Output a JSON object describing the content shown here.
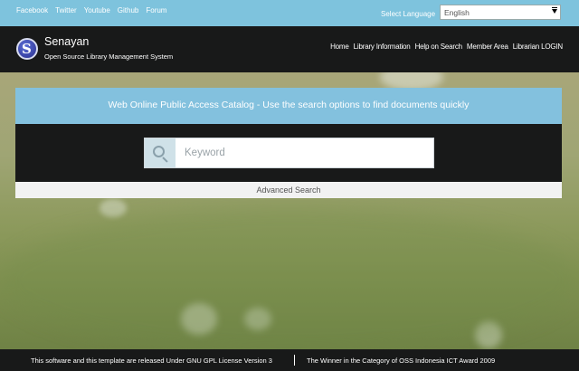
{
  "topbar": {
    "social_links": [
      "Facebook",
      "Twitter",
      "Youtube",
      "Github",
      "Forum"
    ],
    "language_label": "Select Language",
    "language_selected": "English"
  },
  "header": {
    "brand": "Senayan",
    "tagline": "Open Source Library Management System",
    "nav": [
      "Home",
      "Library Information",
      "Help on Search",
      "Member Area",
      "Librarian LOGIN"
    ]
  },
  "search": {
    "title": "Web Online Public Access Catalog - Use the search options to find documents quickly",
    "placeholder": "Keyword",
    "advanced_label": "Advanced Search"
  },
  "footer": {
    "left": "This software and this template are released Under GNU GPL License Version 3",
    "right": "The Winner in the Category of OSS Indonesia ICT Award 2009"
  },
  "colors": {
    "topbar": "#7ec3dd",
    "header": "#181919",
    "panel_title": "#83c1de"
  }
}
